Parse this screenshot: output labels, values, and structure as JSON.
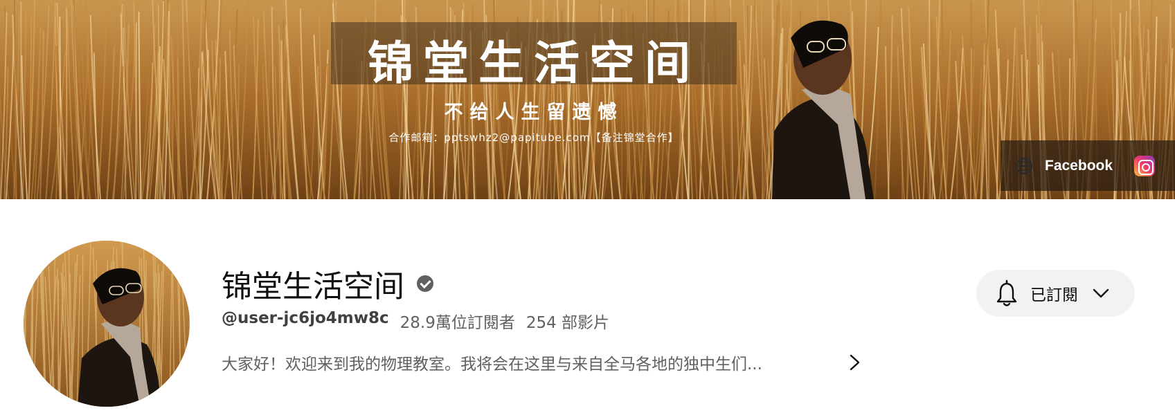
{
  "banner": {
    "title": "锦堂生活空间",
    "subtitle": "不给人生留遗憾",
    "contact": "合作邮箱：pptswhz2@papitube.com【备注锦堂合作】",
    "links": {
      "facebook_label": "Facebook",
      "globe_icon": "globe-icon",
      "instagram_icon": "instagram-icon"
    }
  },
  "channel": {
    "name": "锦堂生活空间",
    "verified_icon": "verified-check-icon",
    "handle": "@user-jc6jo4mw8c",
    "subscribers": "28.9萬位訂閱者",
    "videos": "254 部影片",
    "description": "大家好！欢迎来到我的物理教室。我将会在这里与来自全马各地的独中生们...",
    "more_icon": "chevron-right-icon"
  },
  "subscribe": {
    "label": "已訂閱",
    "bell_icon": "bell-icon",
    "dropdown_icon": "chevron-down-icon"
  },
  "colors": {
    "banner_brown": "#9a6224",
    "text_primary": "#0f0f0f",
    "text_secondary": "#606060",
    "button_bg": "#f2f2f2"
  }
}
